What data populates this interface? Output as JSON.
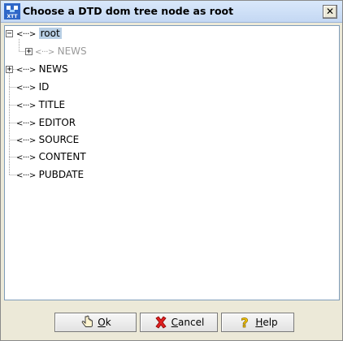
{
  "window": {
    "title": "Choose a DTD dom tree node as root",
    "close_glyph": "✕",
    "app_icon": "xtt-app-icon"
  },
  "tree": {
    "connector": "<···>",
    "nodes": [
      {
        "label": "root",
        "state": "selected"
      },
      {
        "label": "NEWS",
        "state": "dim",
        "expander": "+"
      },
      {
        "label": "NEWS",
        "expander": "+"
      },
      {
        "label": "ID"
      },
      {
        "label": "TITLE"
      },
      {
        "label": "EDITOR"
      },
      {
        "label": "SOURCE"
      },
      {
        "label": "CONTENT"
      },
      {
        "label": "PUBDATE"
      }
    ],
    "root_expander": "−"
  },
  "buttons": {
    "ok": {
      "mnemonic": "O",
      "rest": "k",
      "icon": "hand-pointer-icon"
    },
    "cancel": {
      "mnemonic": "C",
      "rest": "ancel",
      "icon": "red-x-icon"
    },
    "help": {
      "mnemonic": "H",
      "rest": "elp",
      "icon": "question-mark-icon"
    }
  }
}
